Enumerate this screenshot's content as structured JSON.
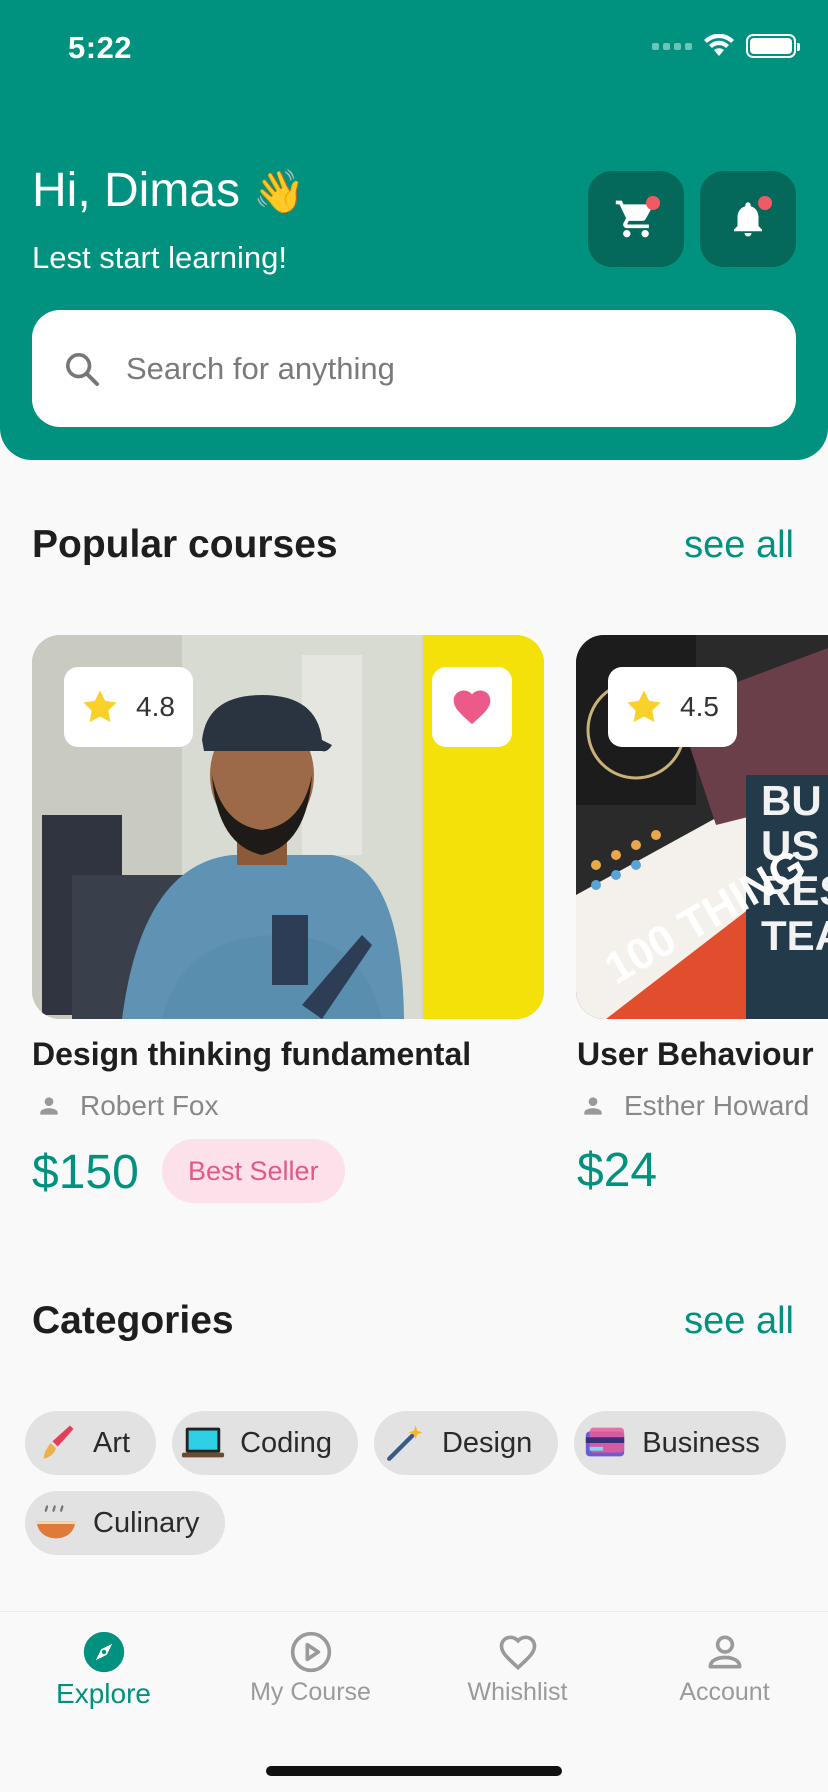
{
  "status_bar": {
    "time": "5:22"
  },
  "header": {
    "greeting": "Hi, Dimas",
    "greeting_emoji": "👋",
    "subtitle": "Lest start learning!",
    "cart_icon": "cart-icon",
    "bell_icon": "bell-icon"
  },
  "search": {
    "placeholder": "Search for anything"
  },
  "popular": {
    "title": "Popular courses",
    "see_all": "see all",
    "courses": [
      {
        "title": "Design thinking fundamental",
        "author": "Robert Fox",
        "price": "$150",
        "rating": "4.8",
        "badge": "Best Seller",
        "favorited": true
      },
      {
        "title": "User Behaviour",
        "author": "Esther Howard",
        "price": "$24",
        "rating": "4.5",
        "badge": "",
        "favorited": false
      }
    ]
  },
  "categories": {
    "title": "Categories",
    "see_all": "see all",
    "items": [
      {
        "label": "Art",
        "emoji": "🖌️"
      },
      {
        "label": "Coding",
        "emoji": "💻"
      },
      {
        "label": "Design",
        "emoji": "🪄"
      },
      {
        "label": "Business",
        "emoji": "💳"
      },
      {
        "label": "Culinary",
        "emoji": "🍜"
      }
    ]
  },
  "nav": {
    "items": [
      {
        "label": "Explore",
        "icon": "compass-icon",
        "active": true
      },
      {
        "label": "My Course",
        "icon": "play-circle-icon",
        "active": false
      },
      {
        "label": "Whishlist",
        "icon": "heart-icon",
        "active": false
      },
      {
        "label": "Account",
        "icon": "person-icon",
        "active": false
      }
    ]
  },
  "colors": {
    "primary": "#00917f",
    "primary_dark": "#04685b",
    "accent_red": "#f05a64",
    "badge_pink": "#e25887"
  }
}
